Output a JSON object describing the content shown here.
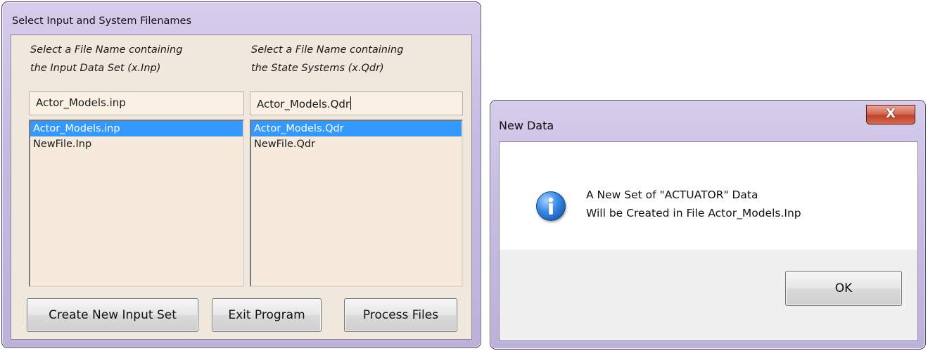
{
  "left_window": {
    "title": "Select Input and System Filenames",
    "input_column": {
      "label_line1": "Select a File Name containing",
      "label_line2": "the Input Data Set (x.Inp)",
      "current_value": "Actor_Models.inp",
      "items": [
        "Actor_Models.inp",
        "NewFile.Inp"
      ],
      "selected_index": 0
    },
    "system_column": {
      "label_line1": "Select a File Name containing",
      "label_line2": "the State Systems (x.Qdr)",
      "current_value": "Actor_Models.Qdr",
      "items": [
        "Actor_Models.Qdr",
        "NewFile.Qdr"
      ],
      "selected_index": 0
    },
    "buttons": {
      "create": "Create New Input Set",
      "exit": "Exit Program",
      "process": "Process Files"
    }
  },
  "dialog": {
    "title": "New Data",
    "close_glyph": "X",
    "icon": "info-icon",
    "message_line1": "A New Set of \"ACTUATOR\" Data",
    "message_line2": "Will be Created in File Actor_Models.Inp",
    "ok_label": "OK"
  },
  "colors": {
    "selection": "#3399ff",
    "frame": "#c6bbe1",
    "client_bg": "#f0e8dc",
    "close_button": "#c0432b"
  }
}
